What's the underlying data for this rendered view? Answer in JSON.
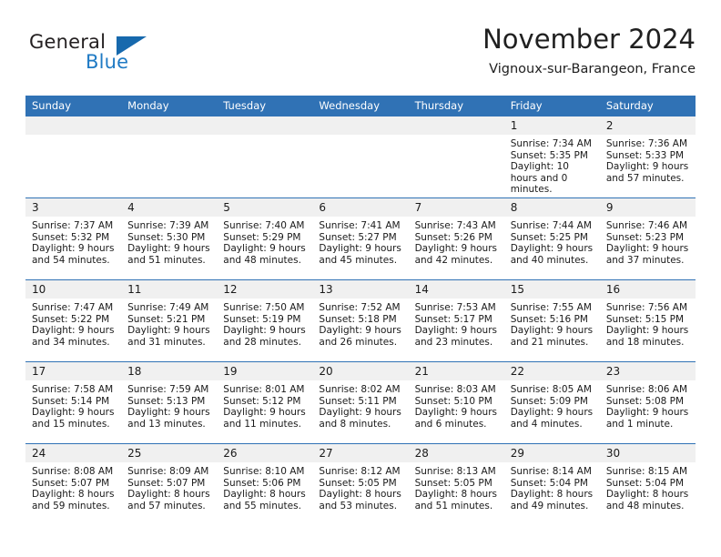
{
  "brand": {
    "name_part1": "General",
    "name_part2": "Blue"
  },
  "header": {
    "title": "November 2024",
    "location": "Vignoux-sur-Barangeon, France"
  },
  "calendar": {
    "weekday_headers": [
      "Sunday",
      "Monday",
      "Tuesday",
      "Wednesday",
      "Thursday",
      "Friday",
      "Saturday"
    ],
    "accent_color": "#3072b5",
    "daynum_band_color": "#f0f0f0",
    "weeks": [
      [
        {
          "day": "",
          "empty": true
        },
        {
          "day": "",
          "empty": true
        },
        {
          "day": "",
          "empty": true
        },
        {
          "day": "",
          "empty": true
        },
        {
          "day": "",
          "empty": true
        },
        {
          "day": "1",
          "sunrise": "Sunrise: 7:34 AM",
          "sunset": "Sunset: 5:35 PM",
          "daylight": "Daylight: 10 hours and 0 minutes."
        },
        {
          "day": "2",
          "sunrise": "Sunrise: 7:36 AM",
          "sunset": "Sunset: 5:33 PM",
          "daylight": "Daylight: 9 hours and 57 minutes."
        }
      ],
      [
        {
          "day": "3",
          "sunrise": "Sunrise: 7:37 AM",
          "sunset": "Sunset: 5:32 PM",
          "daylight": "Daylight: 9 hours and 54 minutes."
        },
        {
          "day": "4",
          "sunrise": "Sunrise: 7:39 AM",
          "sunset": "Sunset: 5:30 PM",
          "daylight": "Daylight: 9 hours and 51 minutes."
        },
        {
          "day": "5",
          "sunrise": "Sunrise: 7:40 AM",
          "sunset": "Sunset: 5:29 PM",
          "daylight": "Daylight: 9 hours and 48 minutes."
        },
        {
          "day": "6",
          "sunrise": "Sunrise: 7:41 AM",
          "sunset": "Sunset: 5:27 PM",
          "daylight": "Daylight: 9 hours and 45 minutes."
        },
        {
          "day": "7",
          "sunrise": "Sunrise: 7:43 AM",
          "sunset": "Sunset: 5:26 PM",
          "daylight": "Daylight: 9 hours and 42 minutes."
        },
        {
          "day": "8",
          "sunrise": "Sunrise: 7:44 AM",
          "sunset": "Sunset: 5:25 PM",
          "daylight": "Daylight: 9 hours and 40 minutes."
        },
        {
          "day": "9",
          "sunrise": "Sunrise: 7:46 AM",
          "sunset": "Sunset: 5:23 PM",
          "daylight": "Daylight: 9 hours and 37 minutes."
        }
      ],
      [
        {
          "day": "10",
          "sunrise": "Sunrise: 7:47 AM",
          "sunset": "Sunset: 5:22 PM",
          "daylight": "Daylight: 9 hours and 34 minutes."
        },
        {
          "day": "11",
          "sunrise": "Sunrise: 7:49 AM",
          "sunset": "Sunset: 5:21 PM",
          "daylight": "Daylight: 9 hours and 31 minutes."
        },
        {
          "day": "12",
          "sunrise": "Sunrise: 7:50 AM",
          "sunset": "Sunset: 5:19 PM",
          "daylight": "Daylight: 9 hours and 28 minutes."
        },
        {
          "day": "13",
          "sunrise": "Sunrise: 7:52 AM",
          "sunset": "Sunset: 5:18 PM",
          "daylight": "Daylight: 9 hours and 26 minutes."
        },
        {
          "day": "14",
          "sunrise": "Sunrise: 7:53 AM",
          "sunset": "Sunset: 5:17 PM",
          "daylight": "Daylight: 9 hours and 23 minutes."
        },
        {
          "day": "15",
          "sunrise": "Sunrise: 7:55 AM",
          "sunset": "Sunset: 5:16 PM",
          "daylight": "Daylight: 9 hours and 21 minutes."
        },
        {
          "day": "16",
          "sunrise": "Sunrise: 7:56 AM",
          "sunset": "Sunset: 5:15 PM",
          "daylight": "Daylight: 9 hours and 18 minutes."
        }
      ],
      [
        {
          "day": "17",
          "sunrise": "Sunrise: 7:58 AM",
          "sunset": "Sunset: 5:14 PM",
          "daylight": "Daylight: 9 hours and 15 minutes."
        },
        {
          "day": "18",
          "sunrise": "Sunrise: 7:59 AM",
          "sunset": "Sunset: 5:13 PM",
          "daylight": "Daylight: 9 hours and 13 minutes."
        },
        {
          "day": "19",
          "sunrise": "Sunrise: 8:01 AM",
          "sunset": "Sunset: 5:12 PM",
          "daylight": "Daylight: 9 hours and 11 minutes."
        },
        {
          "day": "20",
          "sunrise": "Sunrise: 8:02 AM",
          "sunset": "Sunset: 5:11 PM",
          "daylight": "Daylight: 9 hours and 8 minutes."
        },
        {
          "day": "21",
          "sunrise": "Sunrise: 8:03 AM",
          "sunset": "Sunset: 5:10 PM",
          "daylight": "Daylight: 9 hours and 6 minutes."
        },
        {
          "day": "22",
          "sunrise": "Sunrise: 8:05 AM",
          "sunset": "Sunset: 5:09 PM",
          "daylight": "Daylight: 9 hours and 4 minutes."
        },
        {
          "day": "23",
          "sunrise": "Sunrise: 8:06 AM",
          "sunset": "Sunset: 5:08 PM",
          "daylight": "Daylight: 9 hours and 1 minute."
        }
      ],
      [
        {
          "day": "24",
          "sunrise": "Sunrise: 8:08 AM",
          "sunset": "Sunset: 5:07 PM",
          "daylight": "Daylight: 8 hours and 59 minutes."
        },
        {
          "day": "25",
          "sunrise": "Sunrise: 8:09 AM",
          "sunset": "Sunset: 5:07 PM",
          "daylight": "Daylight: 8 hours and 57 minutes."
        },
        {
          "day": "26",
          "sunrise": "Sunrise: 8:10 AM",
          "sunset": "Sunset: 5:06 PM",
          "daylight": "Daylight: 8 hours and 55 minutes."
        },
        {
          "day": "27",
          "sunrise": "Sunrise: 8:12 AM",
          "sunset": "Sunset: 5:05 PM",
          "daylight": "Daylight: 8 hours and 53 minutes."
        },
        {
          "day": "28",
          "sunrise": "Sunrise: 8:13 AM",
          "sunset": "Sunset: 5:05 PM",
          "daylight": "Daylight: 8 hours and 51 minutes."
        },
        {
          "day": "29",
          "sunrise": "Sunrise: 8:14 AM",
          "sunset": "Sunset: 5:04 PM",
          "daylight": "Daylight: 8 hours and 49 minutes."
        },
        {
          "day": "30",
          "sunrise": "Sunrise: 8:15 AM",
          "sunset": "Sunset: 5:04 PM",
          "daylight": "Daylight: 8 hours and 48 minutes."
        }
      ]
    ]
  }
}
